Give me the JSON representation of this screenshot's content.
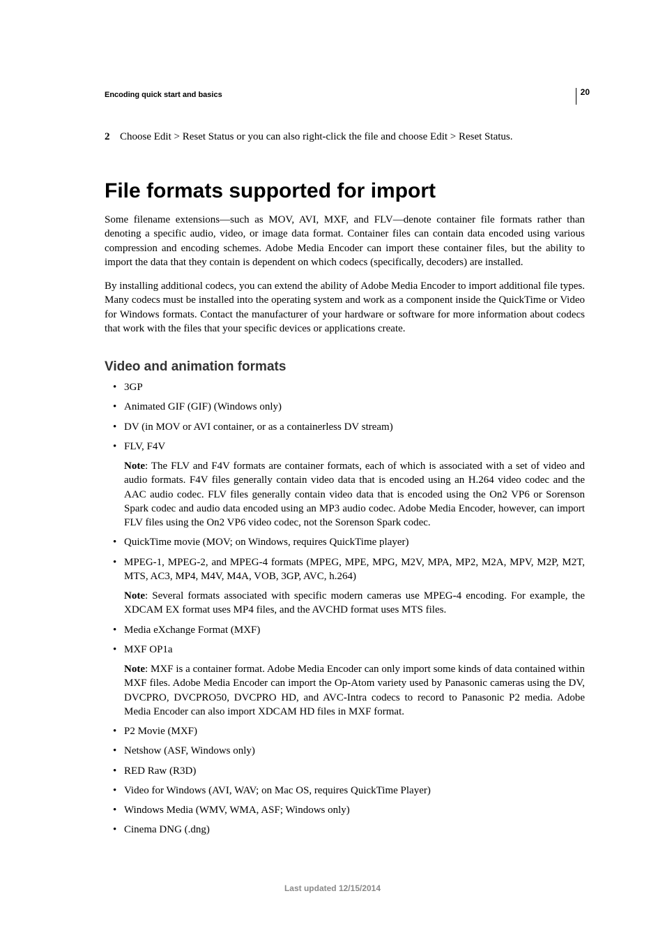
{
  "page_number": "20",
  "running_head": "Encoding quick start and basics",
  "step": {
    "num": "2",
    "text": "Choose Edit > Reset Status or you can also right-click the file and choose Edit > Reset Status."
  },
  "h1": "File formats supported for import",
  "p1": "Some filename extensions—such as MOV, AVI, MXF, and FLV—denote container file formats rather than denoting a specific audio, video, or image data format. Container files can contain data encoded using various compression and encoding schemes. Adobe Media Encoder can import these container files, but the ability to import the data that they contain is dependent on which codecs (specifically, decoders) are installed.",
  "p2": "By installing additional codecs, you can extend the ability of Adobe Media Encoder to import additional file types. Many codecs must be installed into the operating system and work as a component inside the QuickTime or Video for Windows formats. Contact the manufacturer of your hardware or software for more information about codecs that work with the files that your specific devices or applications create.",
  "h2": "Video and animation formats",
  "items": {
    "i0": "3GP",
    "i1": "Animated GIF (GIF) (Windows only)",
    "i2": "DV (in MOV or AVI container, or as a containerless DV stream)",
    "i3": "FLV, F4V",
    "note3_label": "Note",
    "note3": ": The FLV and F4V formats are container formats, each of which is associated with a set of video and audio formats. F4V files generally contain video data that is encoded using an H.264 video codec and the AAC audio codec. FLV files generally contain video data that is encoded using the On2 VP6 or Sorenson Spark codec and audio data encoded using an MP3 audio codec. Adobe Media Encoder, however, can import FLV files using the On2 VP6 video codec, not the Sorenson Spark codec.",
    "i4": "QuickTime movie (MOV; on Windows, requires QuickTime player)",
    "i5": "MPEG-1, MPEG-2, and MPEG-4 formats (MPEG, MPE, MPG, M2V, MPA, MP2, M2A, MPV, M2P, M2T, MTS, AC3, MP4, M4V, M4A, VOB, 3GP, AVC, h.264)",
    "note5_label": "Note",
    "note5": ": Several formats associated with specific modern cameras use MPEG-4 encoding. For example, the XDCAM EX format uses MP4 files, and the AVCHD format uses MTS files.",
    "i6": "Media eXchange Format (MXF)",
    "i7": "MXF OP1a",
    "note7_label": "Note",
    "note7": ": MXF is a container format. Adobe Media Encoder can only import some kinds of data contained within MXF files. Adobe Media Encoder can import the Op-Atom variety used by Panasonic cameras using the DV, DVCPRO, DVCPRO50, DVCPRO HD, and AVC-Intra codecs to record to Panasonic P2 media. Adobe Media Encoder can also import XDCAM HD files in MXF format.",
    "i8": "P2 Movie (MXF)",
    "i9": "Netshow (ASF, Windows only)",
    "i10": "RED Raw (R3D)",
    "i11": "Video for Windows (AVI, WAV; on Mac OS, requires QuickTime Player)",
    "i12": "Windows Media (WMV, WMA, ASF; Windows only)",
    "i13": "Cinema DNG (.dng)"
  },
  "footer": "Last updated 12/15/2014"
}
